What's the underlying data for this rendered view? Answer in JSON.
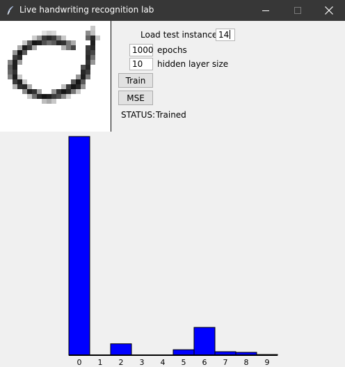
{
  "window": {
    "title": "Live handwriting recognition lab",
    "icon": "feather-icon",
    "controls": [
      "minimize-icon",
      "maximize-icon",
      "close-icon"
    ]
  },
  "drawing_canvas": {
    "description_icon": "handwritten-digit-grid"
  },
  "controls": {
    "load_label": "Load test instance:",
    "load_value": "14",
    "epochs_value": "1000",
    "epochs_label": "epochs",
    "hidden_value": "10",
    "hidden_label": "hidden layer size",
    "train_button": "Train",
    "mse_button": "MSE",
    "status_label": "STATUS:",
    "status_value": "Trained"
  },
  "colors": {
    "bar": "#0000ff",
    "titlebar": "#373737",
    "background": "#f0f0f0"
  },
  "chart_data": {
    "type": "bar",
    "categories": [
      "0",
      "1",
      "2",
      "3",
      "4",
      "5",
      "6",
      "7",
      "8",
      "9"
    ],
    "values": [
      1.0,
      0.0,
      0.052,
      0.0,
      0.0,
      0.025,
      0.127,
      0.016,
      0.013,
      0.003
    ],
    "ylim": [
      0,
      1
    ],
    "grid": false
  }
}
